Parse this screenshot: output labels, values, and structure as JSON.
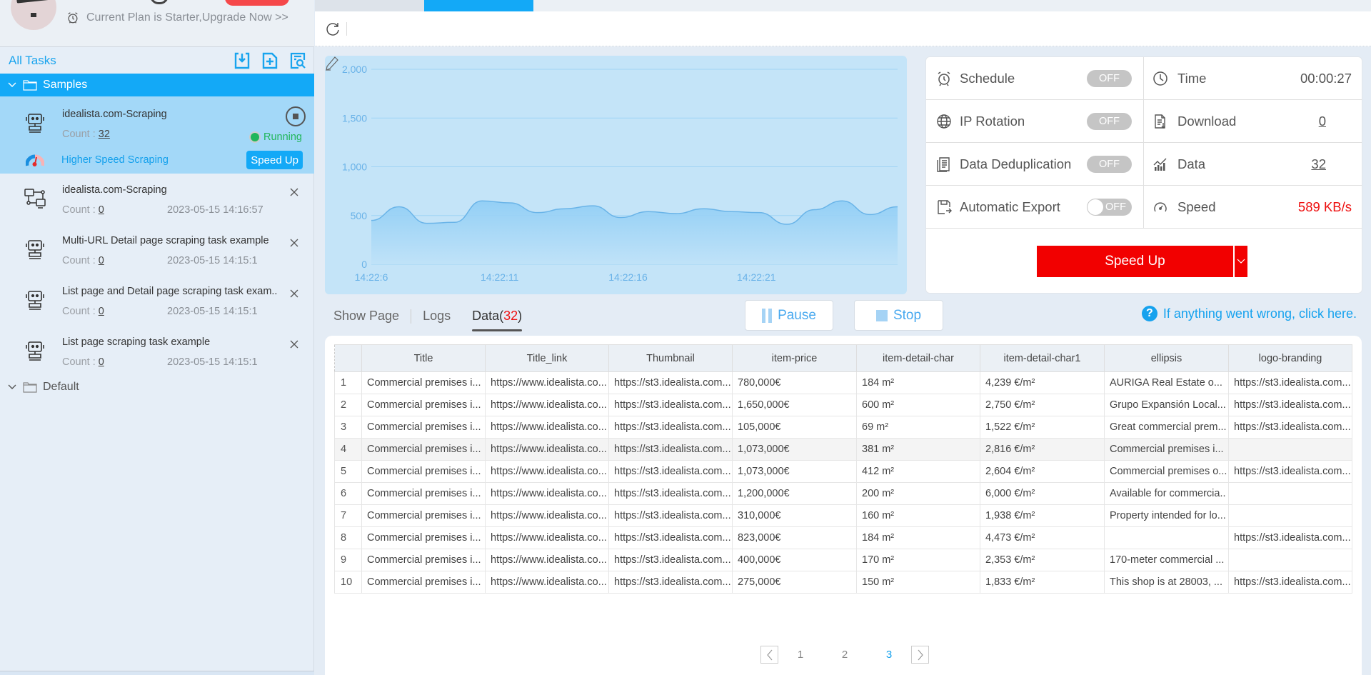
{
  "sidebar": {
    "plan_text": "Current Plan is Starter,Upgrade Now >>",
    "all_tasks_label": "All Tasks",
    "toolbar_icons": [
      "import-task-icon",
      "new-task-icon",
      "search-task-icon"
    ],
    "groups": [
      {
        "label": "Samples",
        "expanded": true,
        "active": true
      },
      {
        "label": "Default",
        "expanded": true,
        "active": false
      }
    ],
    "running_task": {
      "name": "idealista.com-Scraping",
      "count_label": "Count :",
      "count": "32",
      "status": "Running",
      "speed_label": "Higher Speed Scraping",
      "speedup_label": "Speed Up"
    },
    "tasks": [
      {
        "name": "idealista.com-Scraping",
        "count_label": "Count :",
        "count": "0",
        "date": "2023-05-15 14:16:57",
        "icon": "workflow-icon"
      },
      {
        "name": "Multi-URL Detail page scraping task example",
        "count_label": "Count :",
        "count": "0",
        "date": "2023-05-15 14:15:1",
        "icon": "robot-icon"
      },
      {
        "name": "List page and Detail page scraping task exam..",
        "count_label": "Count :",
        "count": "0",
        "date": "2023-05-15 14:15:1",
        "icon": "robot-icon"
      },
      {
        "name": "List page scraping task example",
        "count_label": "Count :",
        "count": "0",
        "date": "2023-05-15 14:15:1",
        "icon": "robot-icon"
      }
    ]
  },
  "stats": {
    "schedule": {
      "label": "Schedule",
      "state": "OFF"
    },
    "ip_rotation": {
      "label": "IP Rotation",
      "state": "OFF"
    },
    "dedup": {
      "label": "Data Deduplication",
      "state": "OFF"
    },
    "auto_export": {
      "label": "Automatic Export",
      "state": "OFF"
    },
    "time": {
      "label": "Time",
      "value": "00:00:27"
    },
    "download": {
      "label": "Download",
      "value": "0"
    },
    "data": {
      "label": "Data",
      "value": "32"
    },
    "speed": {
      "label": "Speed",
      "value": "589 KB/s"
    },
    "speedup_button": "Speed Up"
  },
  "subtabs": {
    "show_page": "Show Page",
    "logs": "Logs",
    "data_label": "Data(",
    "data_count": "32",
    "data_close": ")"
  },
  "controls": {
    "pause": "Pause",
    "stop": "Stop",
    "help": "If anything went wrong, click here."
  },
  "table": {
    "columns": [
      "",
      "Title",
      "Title_link",
      "Thumbnail",
      "item-price",
      "item-detail-char",
      "item-detail-char1",
      "ellipsis",
      "logo-branding"
    ],
    "rows": [
      [
        "1",
        "Commercial premises i...",
        "https://www.idealista.co...",
        "https://st3.idealista.com...",
        "780,000€",
        "184 m²",
        "4,239 €/m²",
        "AURIGA Real Estate o...",
        "https://st3.idealista.com..."
      ],
      [
        "2",
        "Commercial premises i...",
        "https://www.idealista.co...",
        "https://st3.idealista.com...",
        "1,650,000€",
        "600 m²",
        "2,750 €/m²",
        "Grupo Expansión Local...",
        "https://st3.idealista.com..."
      ],
      [
        "3",
        "Commercial premises i...",
        "https://www.idealista.co...",
        "https://st3.idealista.com...",
        "105,000€",
        "69 m²",
        "1,522 €/m²",
        "Great commercial prem...",
        "https://st3.idealista.com..."
      ],
      [
        "4",
        "Commercial premises i...",
        "https://www.idealista.co...",
        "https://st3.idealista.com...",
        "1,073,000€",
        "381 m²",
        "2,816 €/m²",
        "Commercial premises i...",
        ""
      ],
      [
        "5",
        "Commercial premises i...",
        "https://www.idealista.co...",
        "https://st3.idealista.com...",
        "1,073,000€",
        "412 m²",
        "2,604 €/m²",
        "Commercial premises o...",
        "https://st3.idealista.com..."
      ],
      [
        "6",
        "Commercial premises i...",
        "https://www.idealista.co...",
        "https://st3.idealista.com...",
        "1,200,000€",
        "200 m²",
        "6,000 €/m²",
        "Available for commercia..",
        ""
      ],
      [
        "7",
        "Commercial premises i...",
        "https://www.idealista.co...",
        "https://st3.idealista.com...",
        "310,000€",
        "160 m²",
        "1,938 €/m²",
        "Property intended for lo...",
        ""
      ],
      [
        "8",
        "Commercial premises i...",
        "https://www.idealista.co...",
        "https://st3.idealista.com...",
        "823,000€",
        "184 m²",
        "4,473 €/m²",
        "",
        "https://st3.idealista.com..."
      ],
      [
        "9",
        "Commercial premises i...",
        "https://www.idealista.co...",
        "https://st3.idealista.com...",
        "400,000€",
        "170 m²",
        "2,353 €/m²",
        "170-meter commercial ...",
        ""
      ],
      [
        "10",
        "Commercial premises i...",
        "https://www.idealista.co...",
        "https://st3.idealista.com...",
        "275,000€",
        "150 m²",
        "1,833 €/m²",
        "This shop is at 28003, ...",
        "https://st3.idealista.com..."
      ]
    ],
    "highlighted_row": 4
  },
  "pagination": {
    "pages": [
      "1",
      "2",
      "3"
    ],
    "current": "3"
  },
  "chart_data": {
    "type": "area",
    "title": "",
    "xlabel": "",
    "ylabel": "",
    "ylim": [
      0,
      2000
    ],
    "yticks": [
      "2,000",
      "1,500",
      "1,000",
      "500",
      "0"
    ],
    "ytick_values": [
      2000,
      1500,
      1000,
      500,
      0
    ],
    "xticks": [
      "14:22:6",
      "14:22:11",
      "14:22:16",
      "14:22:21"
    ],
    "grid": true,
    "x": [
      6,
      7,
      8,
      9,
      10,
      11,
      12,
      13,
      14,
      15,
      16,
      17,
      18,
      19,
      20,
      21,
      22,
      23,
      24,
      25,
      26,
      27
    ],
    "series": [
      {
        "name": "speed",
        "values": [
          450,
          590,
          420,
          430,
          650,
          630,
          530,
          570,
          600,
          480,
          540,
          520,
          570,
          540,
          530,
          410,
          560,
          650,
          510,
          590
        ]
      }
    ],
    "colors": {
      "line": "#6ab4e8",
      "fill_top": "#8ecdf5",
      "fill_bottom": "#bfe2f8",
      "axis_text": "#69b2e8",
      "grid": "#9fd3f5"
    }
  }
}
